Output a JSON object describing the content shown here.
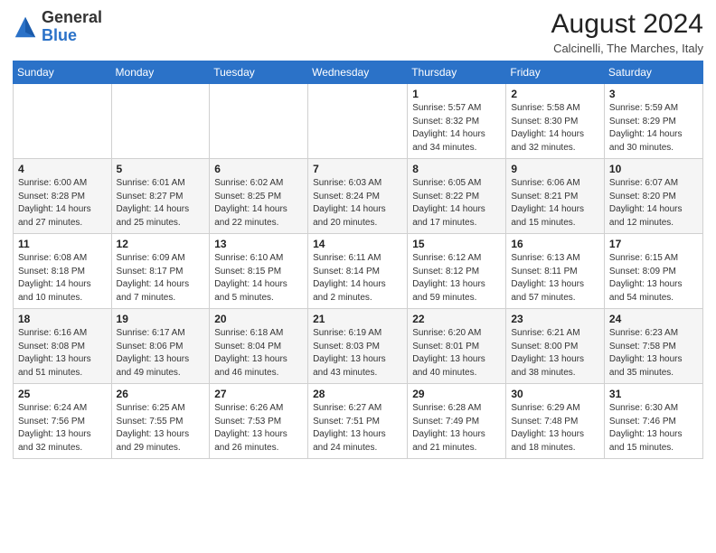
{
  "header": {
    "logo_general": "General",
    "logo_blue": "Blue",
    "month_year": "August 2024",
    "location": "Calcinelli, The Marches, Italy"
  },
  "weekdays": [
    "Sunday",
    "Monday",
    "Tuesday",
    "Wednesday",
    "Thursday",
    "Friday",
    "Saturday"
  ],
  "rows": [
    [
      {
        "day": "",
        "info": ""
      },
      {
        "day": "",
        "info": ""
      },
      {
        "day": "",
        "info": ""
      },
      {
        "day": "",
        "info": ""
      },
      {
        "day": "1",
        "info": "Sunrise: 5:57 AM\nSunset: 8:32 PM\nDaylight: 14 hours\nand 34 minutes."
      },
      {
        "day": "2",
        "info": "Sunrise: 5:58 AM\nSunset: 8:30 PM\nDaylight: 14 hours\nand 32 minutes."
      },
      {
        "day": "3",
        "info": "Sunrise: 5:59 AM\nSunset: 8:29 PM\nDaylight: 14 hours\nand 30 minutes."
      }
    ],
    [
      {
        "day": "4",
        "info": "Sunrise: 6:00 AM\nSunset: 8:28 PM\nDaylight: 14 hours\nand 27 minutes."
      },
      {
        "day": "5",
        "info": "Sunrise: 6:01 AM\nSunset: 8:27 PM\nDaylight: 14 hours\nand 25 minutes."
      },
      {
        "day": "6",
        "info": "Sunrise: 6:02 AM\nSunset: 8:25 PM\nDaylight: 14 hours\nand 22 minutes."
      },
      {
        "day": "7",
        "info": "Sunrise: 6:03 AM\nSunset: 8:24 PM\nDaylight: 14 hours\nand 20 minutes."
      },
      {
        "day": "8",
        "info": "Sunrise: 6:05 AM\nSunset: 8:22 PM\nDaylight: 14 hours\nand 17 minutes."
      },
      {
        "day": "9",
        "info": "Sunrise: 6:06 AM\nSunset: 8:21 PM\nDaylight: 14 hours\nand 15 minutes."
      },
      {
        "day": "10",
        "info": "Sunrise: 6:07 AM\nSunset: 8:20 PM\nDaylight: 14 hours\nand 12 minutes."
      }
    ],
    [
      {
        "day": "11",
        "info": "Sunrise: 6:08 AM\nSunset: 8:18 PM\nDaylight: 14 hours\nand 10 minutes."
      },
      {
        "day": "12",
        "info": "Sunrise: 6:09 AM\nSunset: 8:17 PM\nDaylight: 14 hours\nand 7 minutes."
      },
      {
        "day": "13",
        "info": "Sunrise: 6:10 AM\nSunset: 8:15 PM\nDaylight: 14 hours\nand 5 minutes."
      },
      {
        "day": "14",
        "info": "Sunrise: 6:11 AM\nSunset: 8:14 PM\nDaylight: 14 hours\nand 2 minutes."
      },
      {
        "day": "15",
        "info": "Sunrise: 6:12 AM\nSunset: 8:12 PM\nDaylight: 13 hours\nand 59 minutes."
      },
      {
        "day": "16",
        "info": "Sunrise: 6:13 AM\nSunset: 8:11 PM\nDaylight: 13 hours\nand 57 minutes."
      },
      {
        "day": "17",
        "info": "Sunrise: 6:15 AM\nSunset: 8:09 PM\nDaylight: 13 hours\nand 54 minutes."
      }
    ],
    [
      {
        "day": "18",
        "info": "Sunrise: 6:16 AM\nSunset: 8:08 PM\nDaylight: 13 hours\nand 51 minutes."
      },
      {
        "day": "19",
        "info": "Sunrise: 6:17 AM\nSunset: 8:06 PM\nDaylight: 13 hours\nand 49 minutes."
      },
      {
        "day": "20",
        "info": "Sunrise: 6:18 AM\nSunset: 8:04 PM\nDaylight: 13 hours\nand 46 minutes."
      },
      {
        "day": "21",
        "info": "Sunrise: 6:19 AM\nSunset: 8:03 PM\nDaylight: 13 hours\nand 43 minutes."
      },
      {
        "day": "22",
        "info": "Sunrise: 6:20 AM\nSunset: 8:01 PM\nDaylight: 13 hours\nand 40 minutes."
      },
      {
        "day": "23",
        "info": "Sunrise: 6:21 AM\nSunset: 8:00 PM\nDaylight: 13 hours\nand 38 minutes."
      },
      {
        "day": "24",
        "info": "Sunrise: 6:23 AM\nSunset: 7:58 PM\nDaylight: 13 hours\nand 35 minutes."
      }
    ],
    [
      {
        "day": "25",
        "info": "Sunrise: 6:24 AM\nSunset: 7:56 PM\nDaylight: 13 hours\nand 32 minutes."
      },
      {
        "day": "26",
        "info": "Sunrise: 6:25 AM\nSunset: 7:55 PM\nDaylight: 13 hours\nand 29 minutes."
      },
      {
        "day": "27",
        "info": "Sunrise: 6:26 AM\nSunset: 7:53 PM\nDaylight: 13 hours\nand 26 minutes."
      },
      {
        "day": "28",
        "info": "Sunrise: 6:27 AM\nSunset: 7:51 PM\nDaylight: 13 hours\nand 24 minutes."
      },
      {
        "day": "29",
        "info": "Sunrise: 6:28 AM\nSunset: 7:49 PM\nDaylight: 13 hours\nand 21 minutes."
      },
      {
        "day": "30",
        "info": "Sunrise: 6:29 AM\nSunset: 7:48 PM\nDaylight: 13 hours\nand 18 minutes."
      },
      {
        "day": "31",
        "info": "Sunrise: 6:30 AM\nSunset: 7:46 PM\nDaylight: 13 hours\nand 15 minutes."
      }
    ]
  ]
}
